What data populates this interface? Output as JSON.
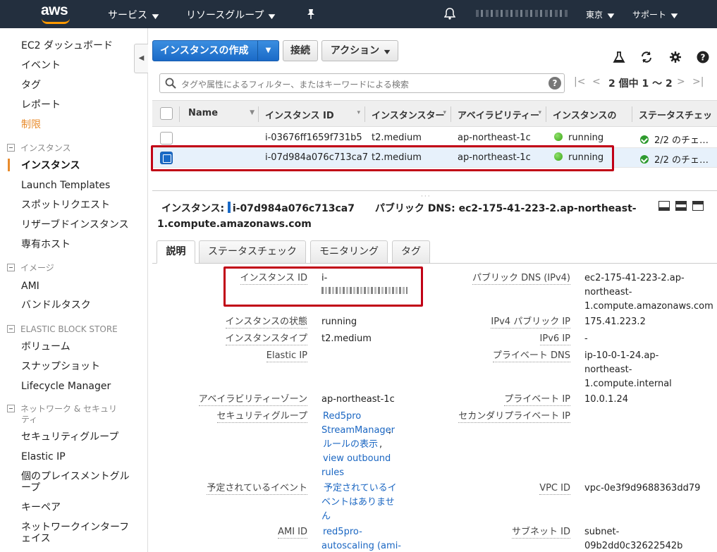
{
  "nav": {
    "logo": "aws",
    "services": "サービス",
    "resource_groups": "リソースグループ",
    "region": "東京",
    "support": "サポート"
  },
  "sidebar": {
    "items": [
      {
        "label": "EC2 ダッシュボード"
      },
      {
        "label": "イベント"
      },
      {
        "label": "タグ"
      },
      {
        "label": "レポート"
      },
      {
        "label": "制限"
      }
    ],
    "sections": [
      {
        "title": "インスタンス",
        "items": [
          "インスタンス",
          "Launch Templates",
          "スポットリクエスト",
          "リザーブドインスタンス",
          "専有ホスト"
        ]
      },
      {
        "title": "イメージ",
        "items": [
          "AMI",
          "バンドルタスク"
        ]
      },
      {
        "title": "ELASTIC BLOCK STORE",
        "items": [
          "ボリューム",
          "スナップショット",
          "Lifecycle Manager"
        ]
      },
      {
        "title_line1": "ネットワーク & セキュリ",
        "title_line2": "ティ",
        "items": [
          "セキュリティグループ",
          "Elastic IP",
          "個のプレイスメントグル",
          "ープ",
          "キーペア",
          "ネットワークインターフ",
          "ェイス"
        ]
      }
    ]
  },
  "toolbar": {
    "create_instance": "インスタンスの作成",
    "connect": "接続",
    "actions": "アクション"
  },
  "filter": {
    "placeholder": "タグや属性によるフィルター、またはキーワードによる検索",
    "pager": "2 個中 1 〜 2"
  },
  "table": {
    "columns": [
      "Name",
      "インスタンス ID",
      "インスタンスター",
      "アベイラビリティー",
      "インスタンスの",
      "ステータスチェッ"
    ],
    "rows": [
      {
        "name": "",
        "id": "i-03676ff1659f731b5",
        "type": "t2.medium",
        "az": "ap-northeast-1c",
        "state": "running",
        "status": "2/2 のチェ…",
        "selected": false
      },
      {
        "name": "",
        "id": "i-07d984a076c713ca7",
        "type": "t2.medium",
        "az": "ap-northeast-1c",
        "state": "running",
        "status": "2/2 のチェ…",
        "selected": true
      }
    ]
  },
  "detail": {
    "instance_label": "インスタンス:",
    "instance_id": "i-07d984a076c713ca7",
    "dns_label": "パブリック DNS:",
    "dns_value_1": "ec2-175-41-223-2.ap-northeast-",
    "dns_value_2": "1.compute.amazonaws.com",
    "tabs": [
      "説明",
      "ステータスチェック",
      "モニタリング",
      "タグ"
    ],
    "left": {
      "instance_id_label": "インスタンス ID",
      "instance_id_prefix": "i-",
      "state_label": "インスタンスの状態",
      "state_value": "running",
      "type_label": "インスタンスタイプ",
      "type_value": "t2.medium",
      "eip_label": "Elastic IP",
      "az_label": "アベイラビリティーゾーン",
      "az_value": "ap-northeast-1c",
      "sg_label": "セキュリティグループ",
      "sg_link1a": "Red5pro",
      "sg_link1b": "StreamManager",
      "sg_link2": "ルールの表示",
      "sg_link3a": "view outbound",
      "sg_link3b": "rules",
      "events_label": "予定されているイベント",
      "events_1": "予定されているイ",
      "events_2": "ベントはありませ",
      "events_3": "ん",
      "ami_label": "AMI ID",
      "ami_1": "red5pro-",
      "ami_2": "autoscaling (ami-"
    },
    "right": {
      "pubdns_label": "パブリック DNS (IPv4)",
      "pubdns_1": "ec2-175-41-223-2.ap-",
      "pubdns_2": "northeast-",
      "pubdns_3": "1.compute.amazonaws.com",
      "ipv4_label": "IPv4 パブリック IP",
      "ipv4_value": "175.41.223.2",
      "ipv6_label": "IPv6 IP",
      "ipv6_value": "-",
      "privdns_label": "プライベート DNS",
      "privdns_1": "ip-10-0-1-24.ap-",
      "privdns_2": "northeast-",
      "privdns_3": "1.compute.internal",
      "privip_label": "プライベート IP",
      "privip_value": "10.0.1.24",
      "secip_label": "セカンダリプライベート IP",
      "vpc_label": "VPC ID",
      "vpc_value": "vpc-0e3f9d9688363dd79",
      "subnet_label": "サブネット ID",
      "subnet_1": "subnet-",
      "subnet_2": "09b2dd0c32622542b"
    }
  }
}
